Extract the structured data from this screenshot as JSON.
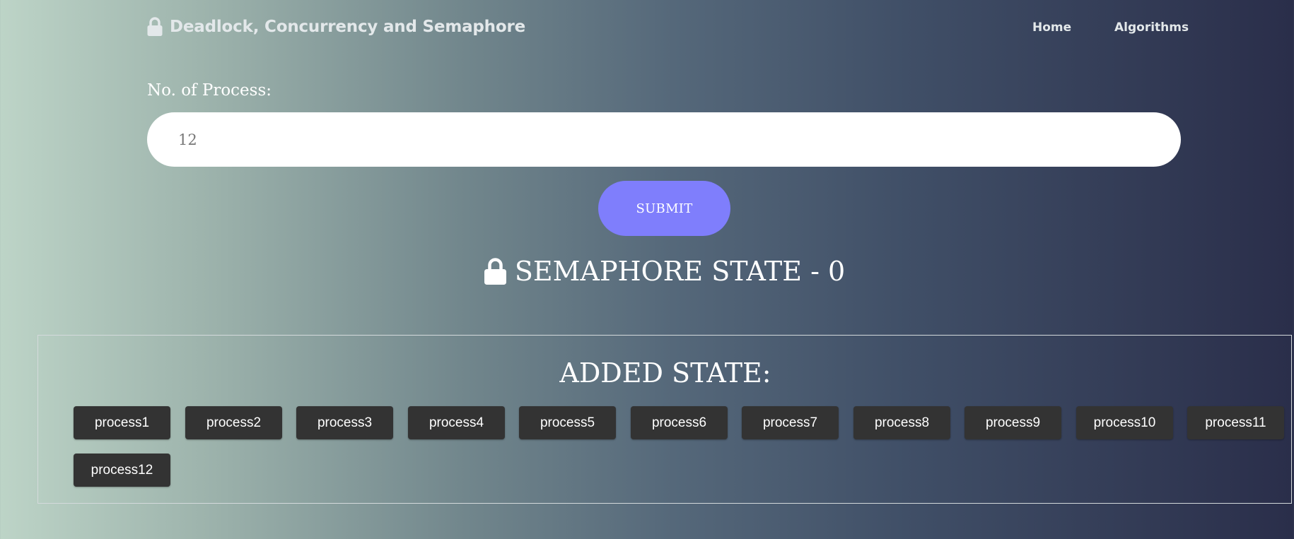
{
  "header": {
    "brand_title": "Deadlock, Concurrency and Semaphore",
    "brand_icon": "lock-icon",
    "nav": [
      {
        "label": "Home"
      },
      {
        "label": "Algorithms"
      }
    ]
  },
  "form": {
    "label": "No. of Process:",
    "input_value": "12",
    "submit_label": "SUBMIT"
  },
  "semaphore": {
    "state_text": "SEMAPHORE STATE - 0",
    "icon": "lock-icon"
  },
  "added": {
    "title": "ADDED STATE:",
    "processes": [
      "process1",
      "process2",
      "process3",
      "process4",
      "process5",
      "process6",
      "process7",
      "process8",
      "process9",
      "process10",
      "process11",
      "process12"
    ]
  },
  "colors": {
    "submit_bg": "#7f7efc",
    "process_btn_bg": "#333333"
  }
}
